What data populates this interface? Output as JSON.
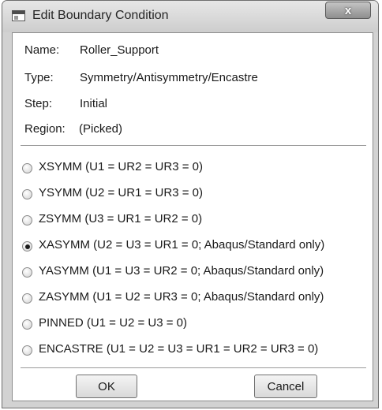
{
  "window": {
    "title": "Edit Boundary Condition",
    "close_label": "x"
  },
  "info": {
    "name_label": "Name:",
    "name_value": "Roller_Support",
    "type_label": "Type:",
    "type_value": "Symmetry/Antisymmetry/Encastre",
    "step_label": "Step:",
    "step_value": "Initial",
    "region_label": "Region:",
    "region_value": "(Picked)"
  },
  "options": [
    {
      "label": "XSYMM (U1 = UR2 = UR3 = 0)",
      "selected": false
    },
    {
      "label": "YSYMM (U2 = UR1 = UR3 = 0)",
      "selected": false
    },
    {
      "label": "ZSYMM (U3 = UR1 = UR2 = 0)",
      "selected": false
    },
    {
      "label": "XASYMM (U2 = U3 = UR1 = 0; Abaqus/Standard only)",
      "selected": true
    },
    {
      "label": "YASYMM (U1 = U3 = UR2 = 0; Abaqus/Standard only)",
      "selected": false
    },
    {
      "label": "ZASYMM (U1 = U2 = UR3 = 0; Abaqus/Standard only)",
      "selected": false
    },
    {
      "label": "PINNED (U1 = U2 = U3 = 0)",
      "selected": false
    },
    {
      "label": "ENCASTRE (U1 = U2 = U3 = UR1 = UR2 = UR3 = 0)",
      "selected": false
    }
  ],
  "buttons": {
    "ok_label": "OK",
    "cancel_label": "Cancel"
  }
}
